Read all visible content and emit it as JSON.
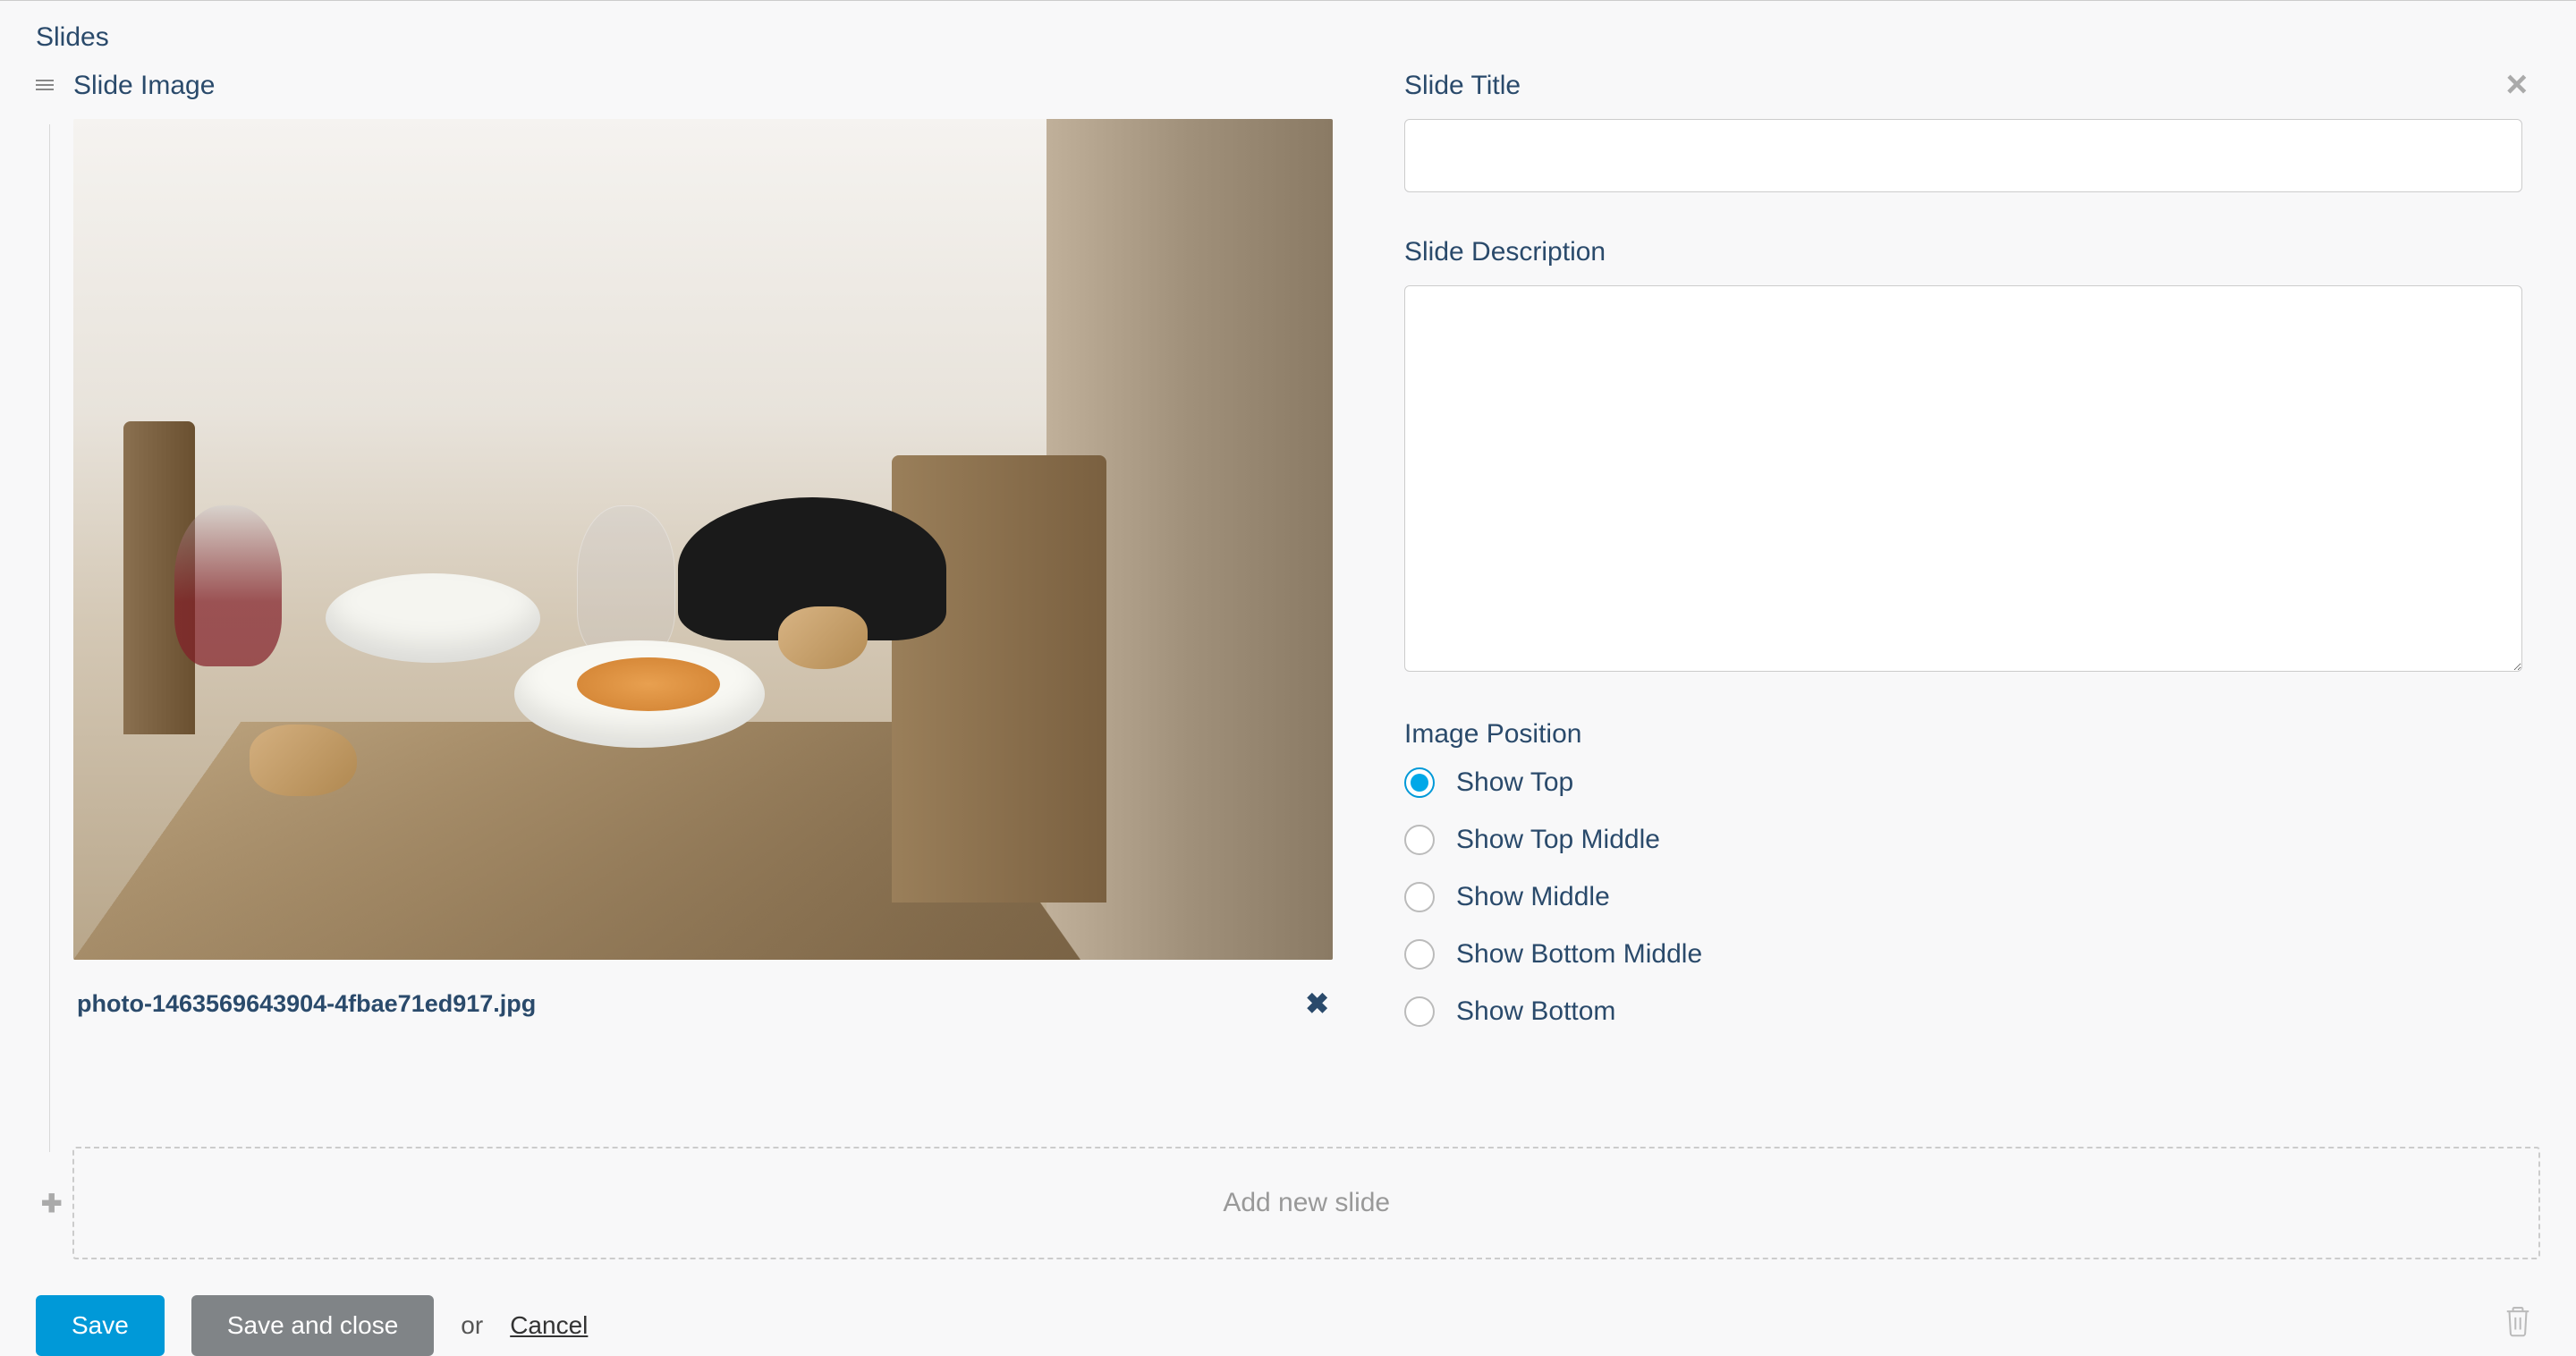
{
  "section_label": "Slides",
  "slide": {
    "image_label": "Slide Image",
    "filename": "photo-1463569643904-4fbae71ed917.jpg",
    "title_label": "Slide Title",
    "title_value": "",
    "description_label": "Slide Description",
    "description_value": "",
    "position_label": "Image Position",
    "positions": [
      {
        "label": "Show Top",
        "checked": true
      },
      {
        "label": "Show Top Middle",
        "checked": false
      },
      {
        "label": "Show Middle",
        "checked": false
      },
      {
        "label": "Show Bottom Middle",
        "checked": false
      },
      {
        "label": "Show Bottom",
        "checked": false
      }
    ]
  },
  "add_slide_label": "Add new slide",
  "footer": {
    "save": "Save",
    "save_close": "Save and close",
    "or": "or",
    "cancel": "Cancel"
  }
}
